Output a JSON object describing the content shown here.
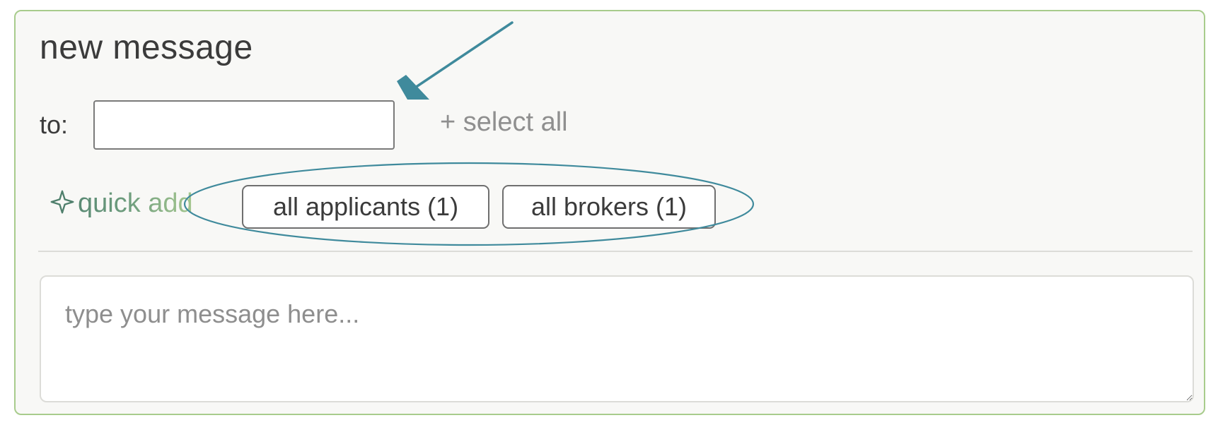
{
  "compose": {
    "title": "new message",
    "to_label": "to:",
    "to_value": "",
    "select_all_label": "+ select all",
    "quick_add_label": "quick add",
    "quick_add_icon": "sparkle-icon",
    "chips": [
      {
        "label": "all applicants (1)"
      },
      {
        "label": "all brokers (1)"
      }
    ],
    "message_value": "",
    "message_placeholder": "type your message here..."
  },
  "annotations": {
    "color": "#3f8a9c",
    "arrow_target": "to-input",
    "ellipse_target": "quick-add-chips"
  },
  "colors": {
    "panel_border": "#a8cc8c",
    "panel_background": "#f8f8f6",
    "quick_add_start": "#5a8a74",
    "quick_add_end": "#a6c890",
    "muted_text": "#8f8f8f"
  }
}
